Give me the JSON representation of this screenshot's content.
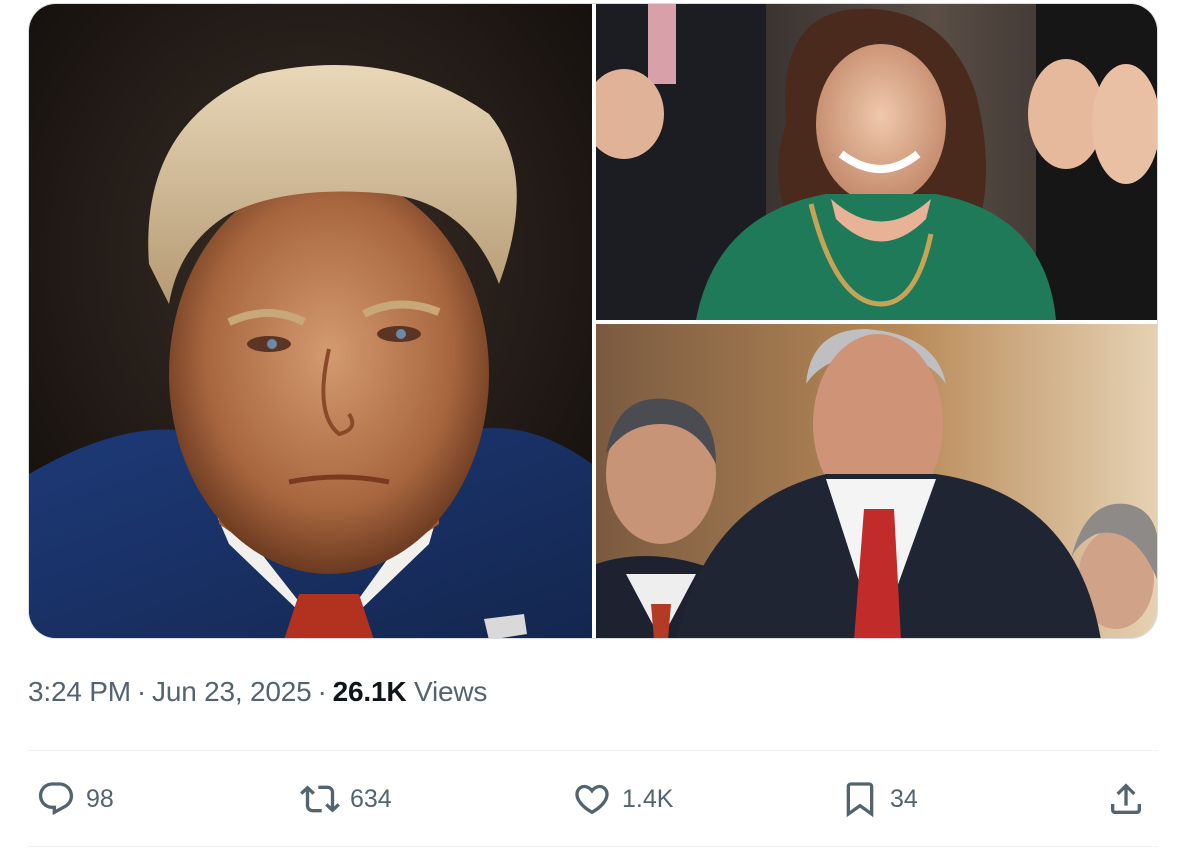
{
  "tweet": {
    "media": [
      {
        "alt": "",
        "icon": "portrait-photo"
      },
      {
        "alt": "",
        "icon": "portrait-photo"
      },
      {
        "alt": "",
        "icon": "group-photo"
      }
    ],
    "time": "3:24 PM",
    "separator": "·",
    "date": "Jun 23, 2025",
    "views_count": "26.1K",
    "views_label": "Views"
  },
  "actions": {
    "reply": {
      "icon": "reply-icon",
      "count": "98"
    },
    "retweet": {
      "icon": "retweet-icon",
      "count": "634"
    },
    "like": {
      "icon": "heart-icon",
      "count": "1.4K"
    },
    "bookmark": {
      "icon": "bookmark-icon",
      "count": "34"
    },
    "share": {
      "icon": "share-icon"
    }
  },
  "colors": {
    "text_secondary": "#536471",
    "text_primary": "#0f1419",
    "divider": "#eff3f4"
  }
}
